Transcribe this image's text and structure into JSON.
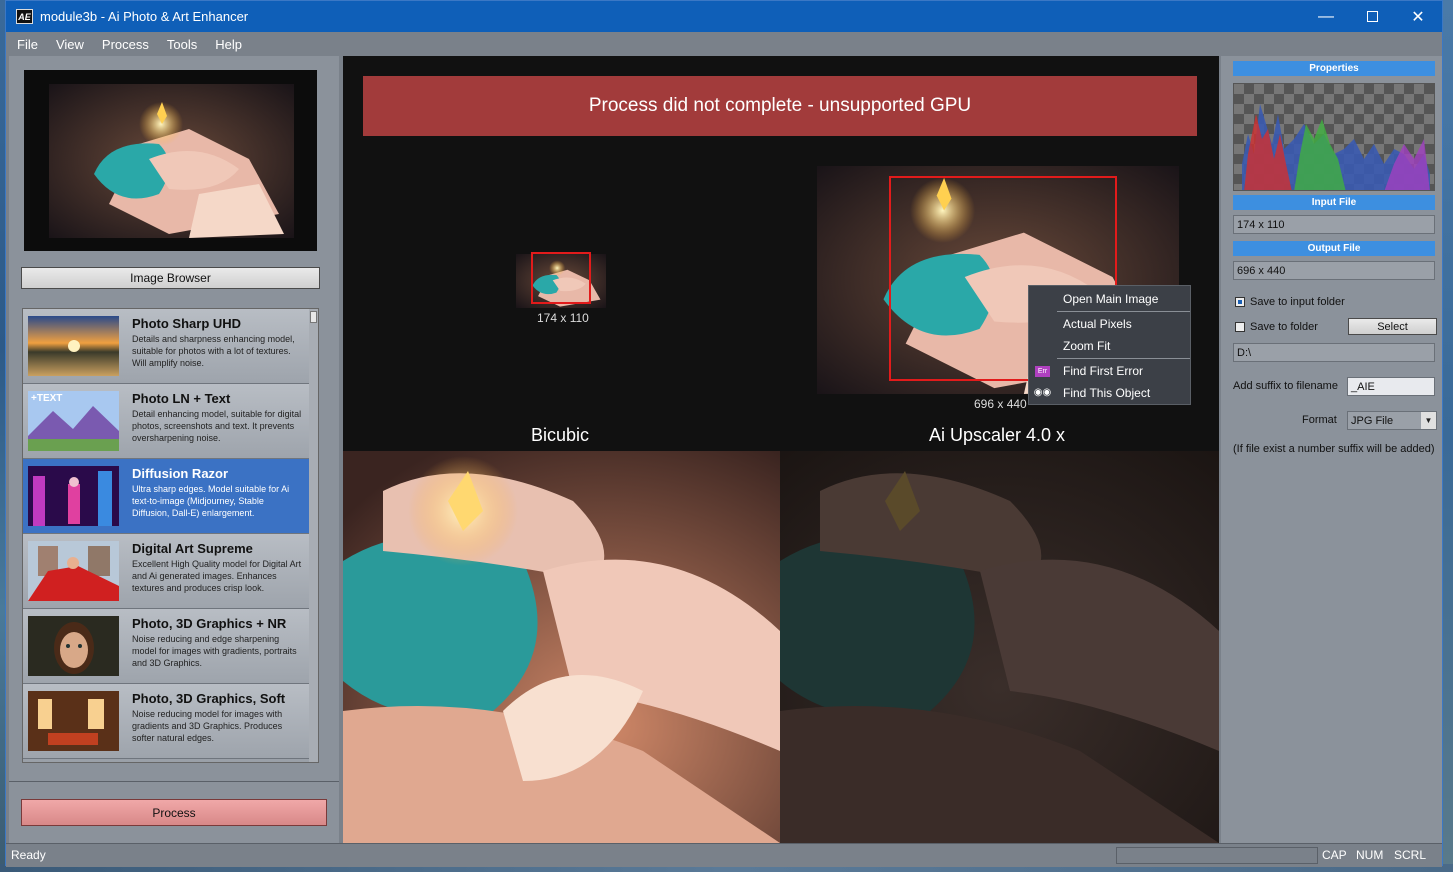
{
  "window": {
    "title": "module3b - Ai Photo & Art Enhancer",
    "app_icon": "AE"
  },
  "menu": [
    "File",
    "View",
    "Process",
    "Tools",
    "Help"
  ],
  "left": {
    "image_browser_label": "Image Browser",
    "process_label": "Process",
    "models": [
      {
        "name": "Photo Sharp UHD",
        "desc": "Details and sharpness enhancing model, suitable for photos with a lot of textures. Will amplify noise."
      },
      {
        "name": "Photo LN + Text",
        "desc": "Detail enhancing model, suitable for digital photos, screenshots and text. It prevents oversharpening noise.",
        "thumb_text": "+TEXT"
      },
      {
        "name": "Diffusion Razor",
        "desc": "Ultra sharp edges. Model suitable for Ai text-to-image (Midjourney, Stable Diffusion, Dall-E) enlargement.",
        "selected": true
      },
      {
        "name": "Digital Art Supreme",
        "desc": "Excellent High Quality model for Digital Art and Ai generated images. Enhances textures and produces crisp look."
      },
      {
        "name": "Photo, 3D Graphics + NR",
        "desc": "Noise reducing and edge sharpening model for images with gradients, portraits and 3D Graphics."
      },
      {
        "name": "Photo, 3D Graphics, Soft",
        "desc": "Noise reducing model for images with gradients and 3D Graphics. Produces softer natural edges."
      }
    ]
  },
  "center": {
    "error": "Process did not complete - unsupported GPU",
    "small_size": "174 x 110",
    "big_size": "696 x 440",
    "left_caption": "Bicubic",
    "right_caption": "Ai Upscaler 4.0 x"
  },
  "context_menu": {
    "items": [
      "Open Main Image",
      "Actual Pixels",
      "Zoom Fit",
      "Find First Error",
      "Find This Object"
    ],
    "err_icon_text": "Err"
  },
  "right": {
    "properties": "Properties",
    "input_file": "Input File",
    "input_value": "174 x 110",
    "output_file": "Output File",
    "output_value": "696 x 440",
    "save_input": "Save to input folder",
    "save_folder": "Save to folder",
    "select": "Select",
    "folder": "D:\\",
    "suffix_label": "Add suffix to filename",
    "suffix_value": "_AIE",
    "format_label": "Format",
    "format_value": "JPG File",
    "note": "(If file exist a number suffix will be added)"
  },
  "status": {
    "text": "Ready",
    "cap": "CAP",
    "num": "NUM",
    "scrl": "SCRL"
  },
  "colors": {
    "titlebar": "#0f5fb8",
    "error": "#a23b3b",
    "selected": "#3b72c4",
    "header": "#3d8fe0",
    "red_box": "#e21b1b"
  }
}
